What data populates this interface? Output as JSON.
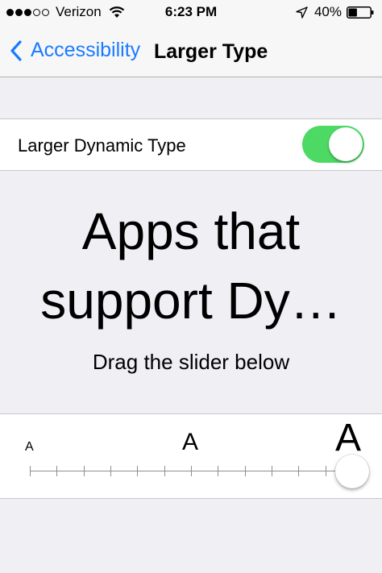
{
  "status_bar": {
    "carrier": "Verizon",
    "time": "6:23 PM",
    "battery_percent": "40%",
    "signal_bars_filled": 3,
    "signal_bars_total": 5,
    "battery_level": 0.4
  },
  "nav": {
    "back_label": "Accessibility",
    "title": "Larger Type"
  },
  "toggle_row": {
    "label": "Larger Dynamic Type",
    "on": true
  },
  "preview": {
    "line1": "Apps that",
    "line2": "support Dy…"
  },
  "instructions": "Drag the slider below",
  "slider": {
    "small_label": "A",
    "medium_label": "A",
    "large_label": "A",
    "steps": 12,
    "value_step": 12
  },
  "colors": {
    "accent": "#1a7bff",
    "switch_on": "#4cd964"
  },
  "icons": [
    "wifi-icon",
    "location-arrow-icon",
    "battery-icon",
    "back-chevron-icon"
  ]
}
